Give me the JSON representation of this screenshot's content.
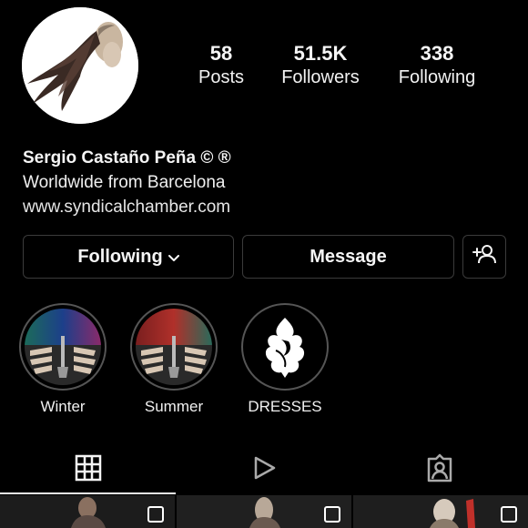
{
  "profile": {
    "name": "Sergio Castaño Peña © ®",
    "bio_line": "Worldwide from Barcelona",
    "website": "www.syndicalchamber.com"
  },
  "stats": {
    "posts": {
      "value": "58",
      "label": "Posts"
    },
    "followers": {
      "value": "51.5K",
      "label": "Followers"
    },
    "following": {
      "value": "338",
      "label": "Following"
    }
  },
  "actions": {
    "following_label": "Following",
    "message_label": "Message",
    "add_user_icon": "add-user-icon"
  },
  "highlights": [
    {
      "label": "Winter"
    },
    {
      "label": "Summer"
    },
    {
      "label": "DRESSES"
    }
  ],
  "tabs": [
    {
      "icon": "grid-icon",
      "active": true
    },
    {
      "icon": "reels-icon",
      "active": false
    },
    {
      "icon": "tagged-icon",
      "active": false
    }
  ],
  "colors": {
    "background": "#000000",
    "text": "#f5f5f5",
    "button_border": "#3b3b3b"
  }
}
